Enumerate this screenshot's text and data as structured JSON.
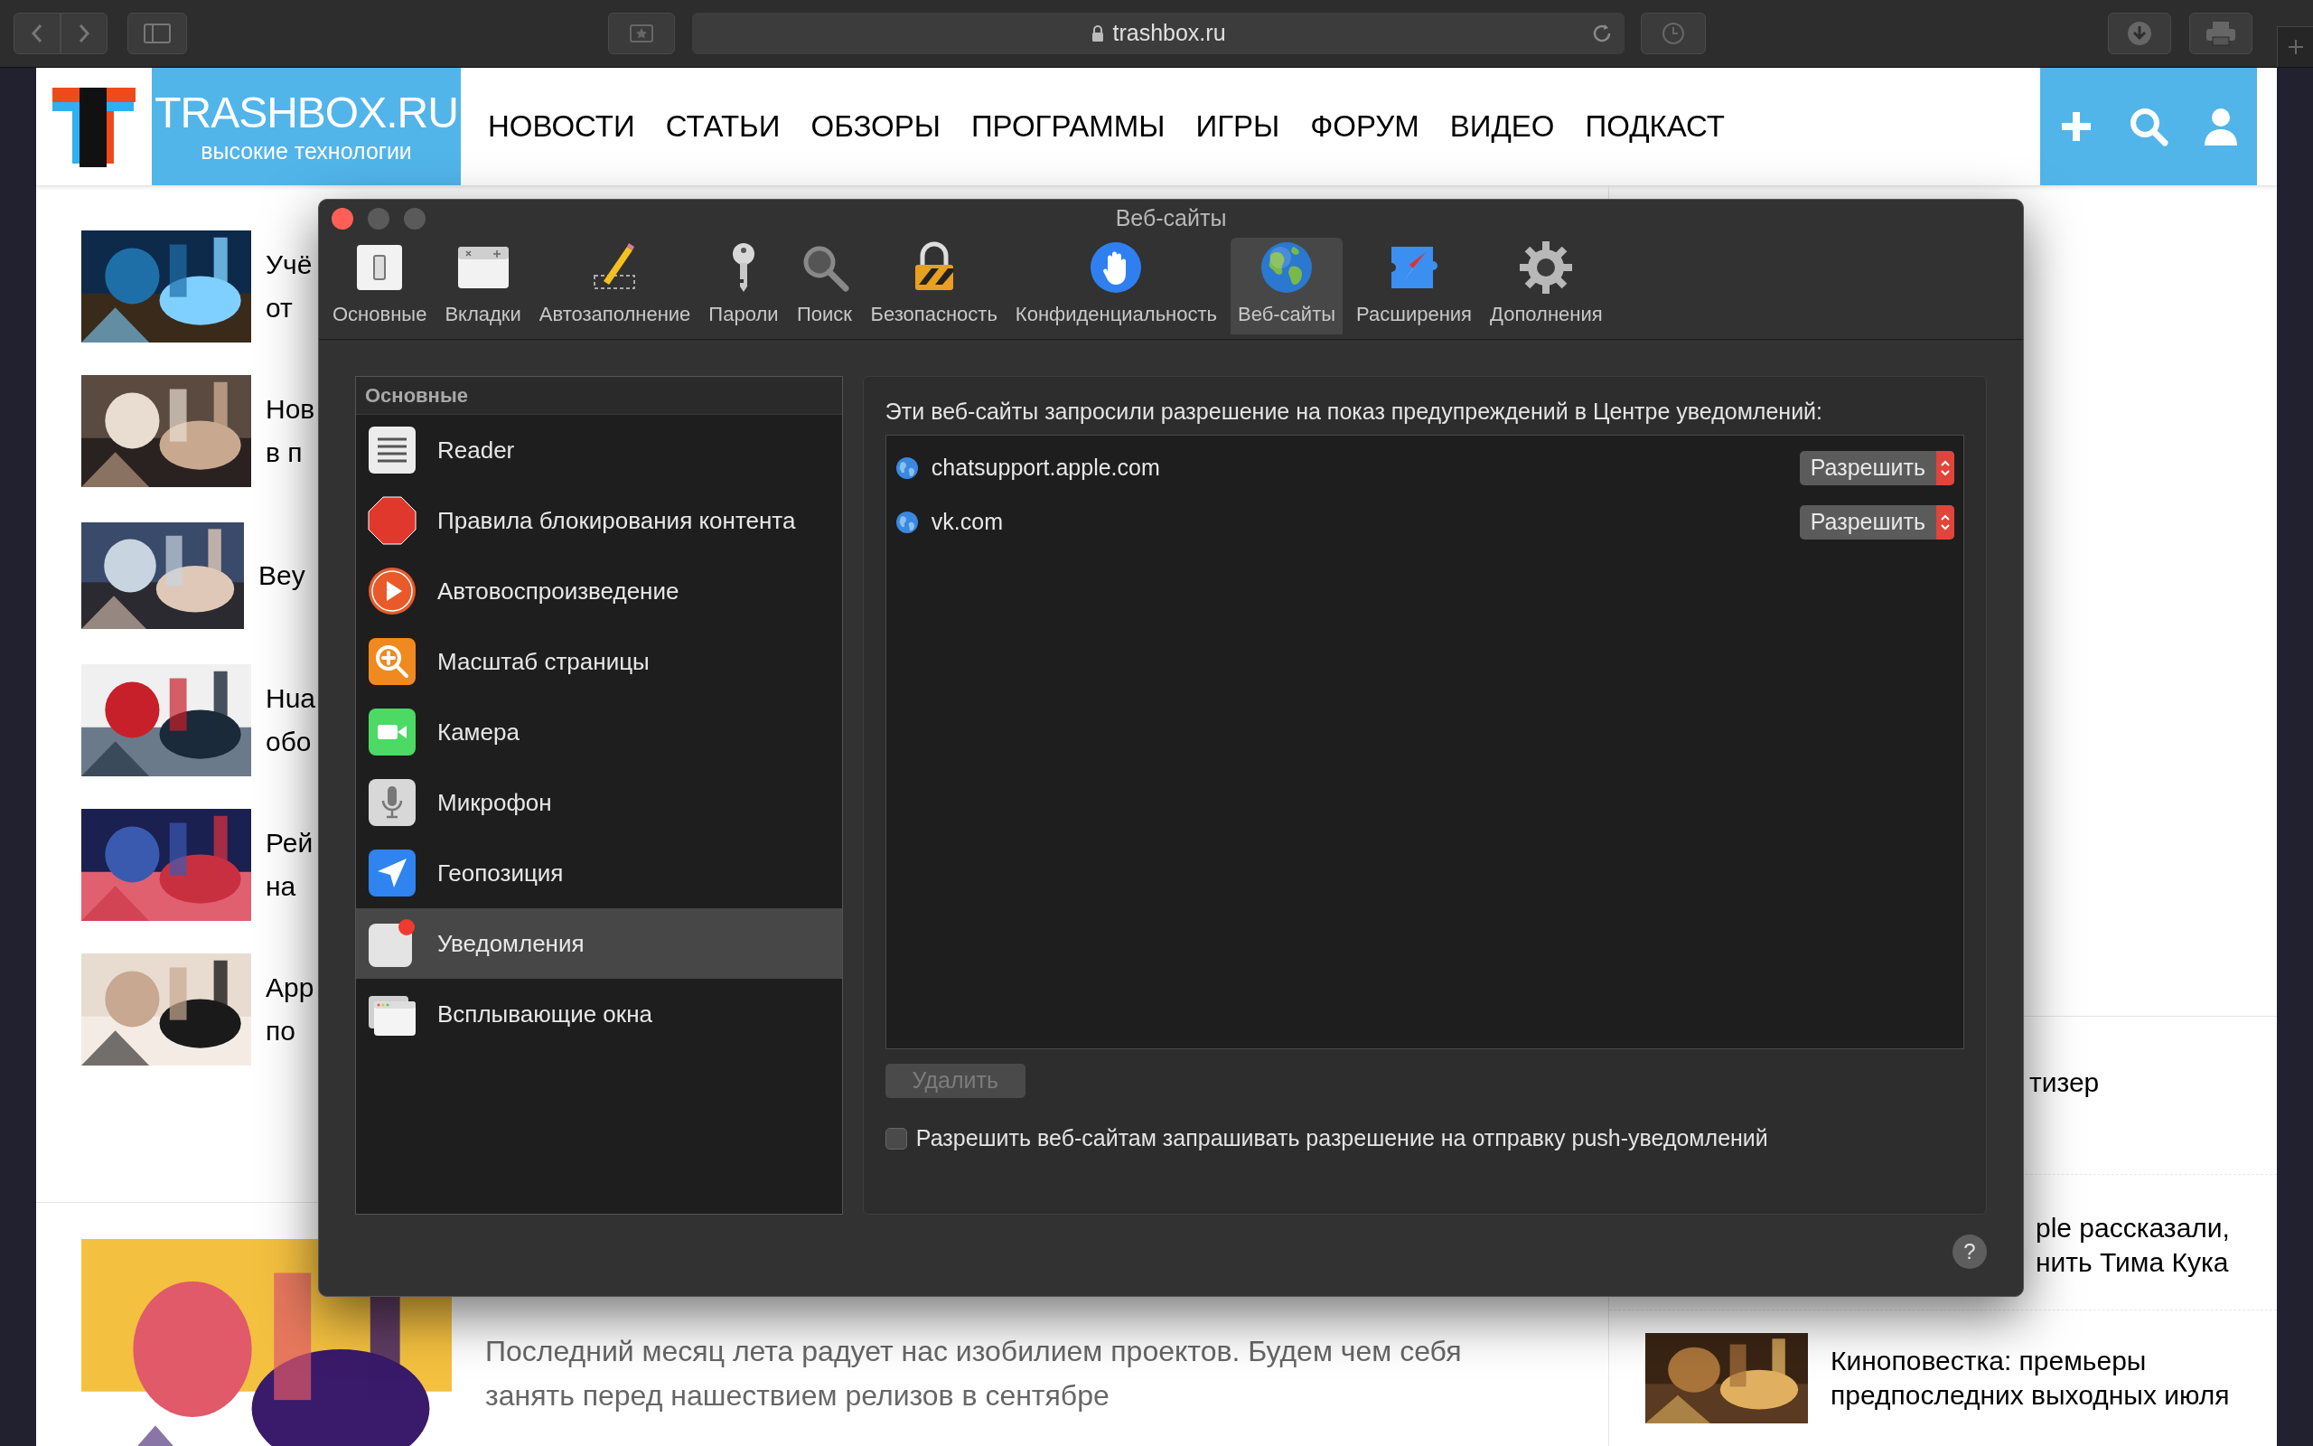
{
  "browser": {
    "url": "trashbox.ru"
  },
  "site": {
    "logo_title": "TRASHBOX.RU",
    "logo_subtitle": "высокие технологии",
    "nav": [
      "НОВОСТИ",
      "СТАТЬИ",
      "ОБЗОРЫ",
      "ПРОГРАММЫ",
      "ИГРЫ",
      "ФОРУМ",
      "ВИДЕО",
      "ПОДКАСТ"
    ]
  },
  "articles": [
    {
      "title_lines": [
        "Учё",
        "от"
      ]
    },
    {
      "title_lines": [
        "Нов",
        "в п"
      ]
    },
    {
      "title_lines": [
        "Bey"
      ]
    },
    {
      "title_lines": [
        "Hua",
        "обо"
      ]
    },
    {
      "title_lines": [
        "Рей",
        "на"
      ]
    },
    {
      "title_lines": [
        "App",
        "по"
      ]
    }
  ],
  "feature": {
    "lead": "Последний месяц лета радует нас изобилием проектов. Будем чем себя занять перед нашествием релизов в сентябре"
  },
  "sidebar_news": [
    {
      "title_lines": [
        "тизер"
      ]
    },
    {
      "title_lines": [
        "ple рассказали,",
        "нить Тима Кука"
      ]
    },
    {
      "title_lines": [
        "Киноповестка: премьеры",
        "предпоследних выходных июля"
      ]
    }
  ],
  "dialog": {
    "title": "Веб-сайты",
    "toolbar": [
      {
        "kind": "general",
        "label": "Основные",
        "selected": false
      },
      {
        "kind": "tabs",
        "label": "Вкладки",
        "selected": false
      },
      {
        "kind": "autofill",
        "label": "Автозаполнение",
        "selected": false
      },
      {
        "kind": "passwords",
        "label": "Пароли",
        "selected": false
      },
      {
        "kind": "search",
        "label": "Поиск",
        "selected": false
      },
      {
        "kind": "security",
        "label": "Безопасность",
        "selected": false
      },
      {
        "kind": "privacy",
        "label": "Конфиденциальность",
        "selected": false
      },
      {
        "kind": "websites",
        "label": "Веб-сайты",
        "selected": true
      },
      {
        "kind": "extensions",
        "label": "Расширения",
        "selected": false
      },
      {
        "kind": "advanced",
        "label": "Дополнения",
        "selected": false
      }
    ],
    "sidebar": {
      "header": "Основные",
      "items": [
        {
          "kind": "reader",
          "label": "Reader",
          "selected": false
        },
        {
          "kind": "blocking",
          "label": "Правила блокирования контента",
          "selected": false
        },
        {
          "kind": "autoplay",
          "label": "Автовоспроизведение",
          "selected": false
        },
        {
          "kind": "zoom",
          "label": "Масштаб страницы",
          "selected": false
        },
        {
          "kind": "camera",
          "label": "Камера",
          "selected": false
        },
        {
          "kind": "microphone",
          "label": "Микрофон",
          "selected": false
        },
        {
          "kind": "location",
          "label": "Геопозиция",
          "selected": false
        },
        {
          "kind": "notifications",
          "label": "Уведомления",
          "selected": true
        },
        {
          "kind": "popups",
          "label": "Всплывающие окна",
          "selected": false
        }
      ]
    },
    "description": "Эти веб-сайты запросили разрешение на показ предупреждений в Центре уведомлений:",
    "sites": [
      {
        "name": "chatsupport.apple.com",
        "permission": "Разрешить"
      },
      {
        "name": "vk.com",
        "permission": "Разрешить"
      }
    ],
    "delete_button": {
      "label": "Удалить",
      "disabled": true
    },
    "push_checkbox": {
      "label": "Разрешить веб-сайтам запрашивать разрешение на отправку push-уведомлений",
      "checked": false
    },
    "help": "?"
  }
}
